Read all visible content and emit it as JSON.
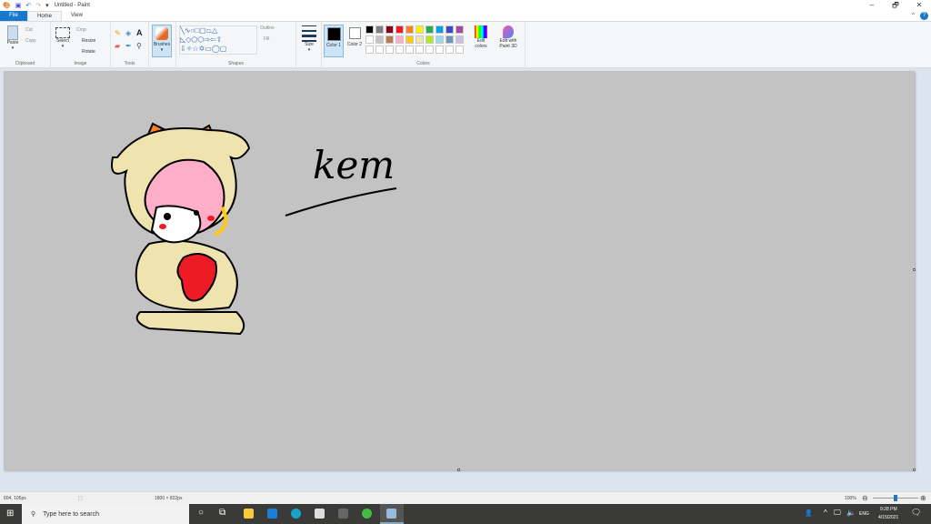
{
  "window": {
    "title": "Untitled - Paint",
    "minimize": "–",
    "maximize": "🗗",
    "close": "✕"
  },
  "tabs": [
    {
      "label": "File"
    },
    {
      "label": "Home"
    },
    {
      "label": "View"
    }
  ],
  "ribbon": {
    "clipboard": {
      "label": "Clipboard",
      "paste": "Paste",
      "cut": "Cut",
      "copy": "Copy"
    },
    "image": {
      "label": "Image",
      "select": "Select",
      "crop": "Crop",
      "resize": "Resize",
      "rotate": "Rotate"
    },
    "tools": {
      "label": "Tools"
    },
    "brushes": {
      "label": "Brushes"
    },
    "shapes": {
      "label": "Shapes",
      "outline": "Outline",
      "fill": "Fill"
    },
    "size": {
      "label": "Size"
    },
    "colors": {
      "label": "Colors",
      "color1": "Color 1",
      "color2": "Color 2",
      "edit_colors": "Edit colors",
      "edit_3d": "Edit with Paint 3D",
      "color1_value": "#000000",
      "color2_value": "#ffffff",
      "palette_row1": [
        "#000000",
        "#7f7f7f",
        "#880015",
        "#ed1c24",
        "#ff7f27",
        "#fff200",
        "#22b14c",
        "#00a2e8",
        "#3f48cc",
        "#a349a4"
      ],
      "palette_row2": [
        "#ffffff",
        "#c3c3c3",
        "#b97a57",
        "#ffaec9",
        "#ffc90e",
        "#efe4b0",
        "#b5e61d",
        "#99d9ea",
        "#7092be",
        "#c8bfe7"
      ]
    }
  },
  "canvas": {
    "handwriting": "kem"
  },
  "status": {
    "cursor_pos": "604, 105px",
    "canvas_size": "1800 × 822px",
    "zoom": "100%",
    "zoom_percent": 100
  },
  "taskbar": {
    "search_placeholder": "Type here to search",
    "time": "9:28 PM",
    "date": "4/15/2021",
    "lang": "ENG"
  }
}
